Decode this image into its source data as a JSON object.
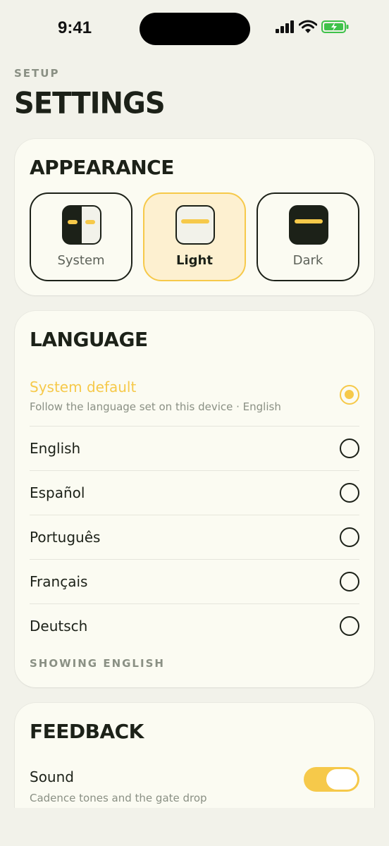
{
  "status_bar": {
    "time": "9:41"
  },
  "header": {
    "eyebrow": "SETUP",
    "title": "SETTINGS"
  },
  "appearance": {
    "title": "APPEARANCE",
    "options": [
      {
        "label": "System",
        "selected": false
      },
      {
        "label": "Light",
        "selected": true
      },
      {
        "label": "Dark",
        "selected": false
      }
    ]
  },
  "language": {
    "title": "LANGUAGE",
    "options": [
      {
        "label": "System default",
        "subtitle": "Follow the language set on this device · English",
        "selected": true
      },
      {
        "label": "English",
        "selected": false
      },
      {
        "label": "Español",
        "selected": false
      },
      {
        "label": "Português",
        "selected": false
      },
      {
        "label": "Français",
        "selected": false
      },
      {
        "label": "Deutsch",
        "selected": false
      }
    ],
    "note": "SHOWING ENGLISH"
  },
  "feedback": {
    "title": "FEEDBACK",
    "sound": {
      "label": "Sound",
      "subtitle": "Cadence tones and the gate drop",
      "enabled": true
    }
  },
  "colors": {
    "accent": "#f6c94a",
    "background": "#f2f2ea",
    "card": "#fbfbf2",
    "ink": "#1c2118",
    "muted": "#8a9084",
    "battery": "#3fc24a"
  }
}
